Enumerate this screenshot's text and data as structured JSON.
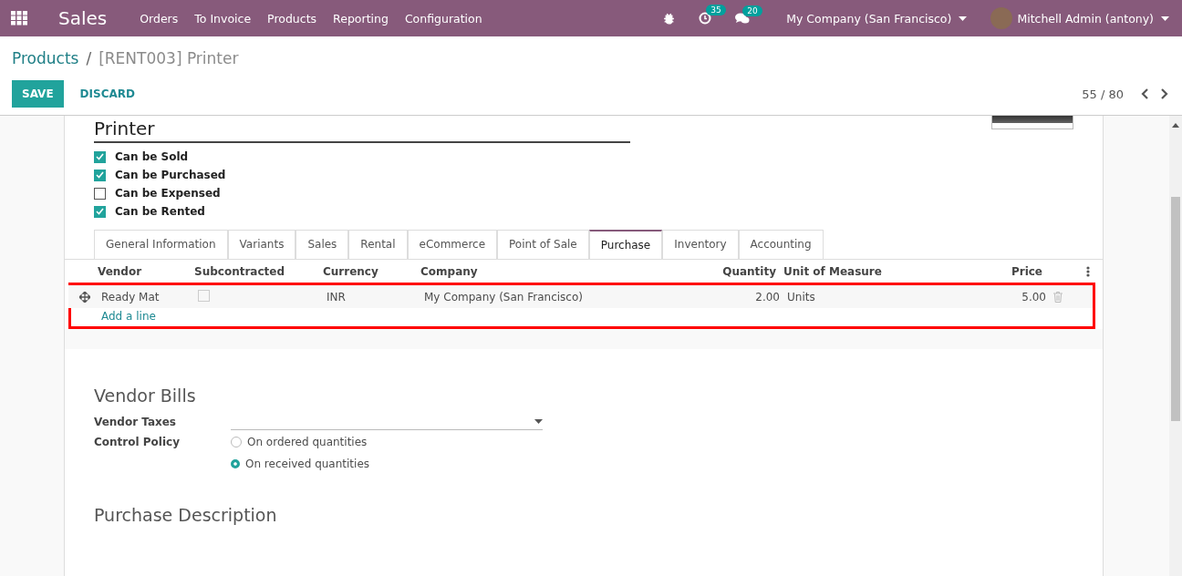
{
  "navbar": {
    "app": "Sales",
    "menu": [
      "Orders",
      "To Invoice",
      "Products",
      "Reporting",
      "Configuration"
    ],
    "activity_badge": "35",
    "message_badge": "20",
    "company": "My Company (San Francisco)",
    "user": "Mitchell Admin (antony)"
  },
  "breadcrumb": {
    "parent": "Products",
    "separator": "/",
    "current": "[RENT003] Printer"
  },
  "actions": {
    "save": "SAVE",
    "discard": "DISCARD"
  },
  "pager": "55 / 80",
  "product": {
    "name": "Printer"
  },
  "options": [
    {
      "label": "Can be Sold",
      "checked": true
    },
    {
      "label": "Can be Purchased",
      "checked": true
    },
    {
      "label": "Can be Expensed",
      "checked": false
    },
    {
      "label": "Can be Rented",
      "checked": true
    }
  ],
  "tabs": [
    {
      "label": "General Information",
      "selected": false
    },
    {
      "label": "Variants",
      "selected": false
    },
    {
      "label": "Sales",
      "selected": false
    },
    {
      "label": "Rental",
      "selected": false
    },
    {
      "label": "eCommerce",
      "selected": false
    },
    {
      "label": "Point of Sale",
      "selected": false
    },
    {
      "label": "Purchase",
      "selected": true
    },
    {
      "label": "Inventory",
      "selected": false
    },
    {
      "label": "Accounting",
      "selected": false
    }
  ],
  "table": {
    "columns": [
      "Vendor",
      "Subcontracted",
      "Currency",
      "Company",
      "Quantity",
      "Unit of Measure",
      "Price"
    ],
    "rows": [
      {
        "vendor": "Ready Mat",
        "subcontracted": false,
        "currency": "INR",
        "company": "My Company (San Francisco)",
        "quantity": "2.00",
        "uom": "Units",
        "price": "5.00"
      }
    ],
    "add_line": "Add a line"
  },
  "vendor_bills": {
    "title": "Vendor Bills",
    "taxes_label": "Vendor Taxes",
    "policy_label": "Control Policy",
    "policies": [
      {
        "label": "On ordered quantities",
        "selected": false
      },
      {
        "label": "On received quantities",
        "selected": true
      }
    ]
  },
  "next_section": "Purchase Description"
}
